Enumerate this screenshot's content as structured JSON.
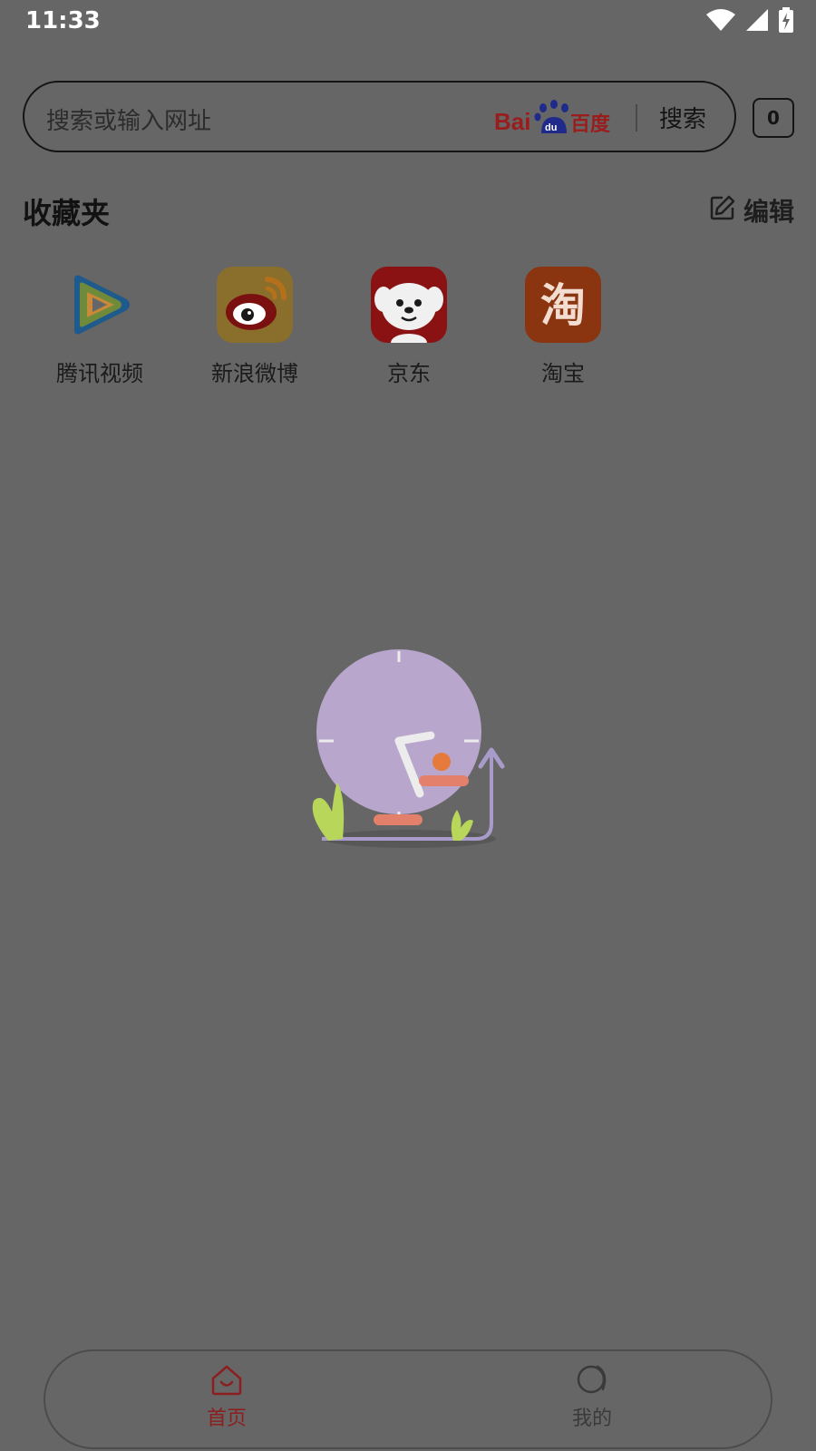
{
  "status_bar": {
    "time": "11:33",
    "icons": [
      "wifi-icon",
      "signal-icon",
      "battery-charging-icon"
    ]
  },
  "search": {
    "placeholder": "搜索或输入网址",
    "engine_logo": "baidu-logo",
    "button_label": "搜索"
  },
  "tabs": {
    "count": "0"
  },
  "favorites": {
    "title": "收藏夹",
    "edit_label": "编辑",
    "items": [
      {
        "label": "腾讯视频",
        "icon": "tencent-video-icon"
      },
      {
        "label": "新浪微博",
        "icon": "weibo-icon"
      },
      {
        "label": "京东",
        "icon": "jd-icon"
      },
      {
        "label": "淘宝",
        "icon": "taobao-icon"
      }
    ]
  },
  "empty_state": {
    "illustration": "clock-illustration"
  },
  "bottom_nav": {
    "items": [
      {
        "label": "首页",
        "icon": "home-icon",
        "active": true
      },
      {
        "label": "我的",
        "icon": "profile-icon",
        "active": false
      }
    ]
  },
  "colors": {
    "overlay_background": "#666666",
    "active_tab": "#8b1f1f",
    "inactive_tab": "#3a3a3a"
  }
}
